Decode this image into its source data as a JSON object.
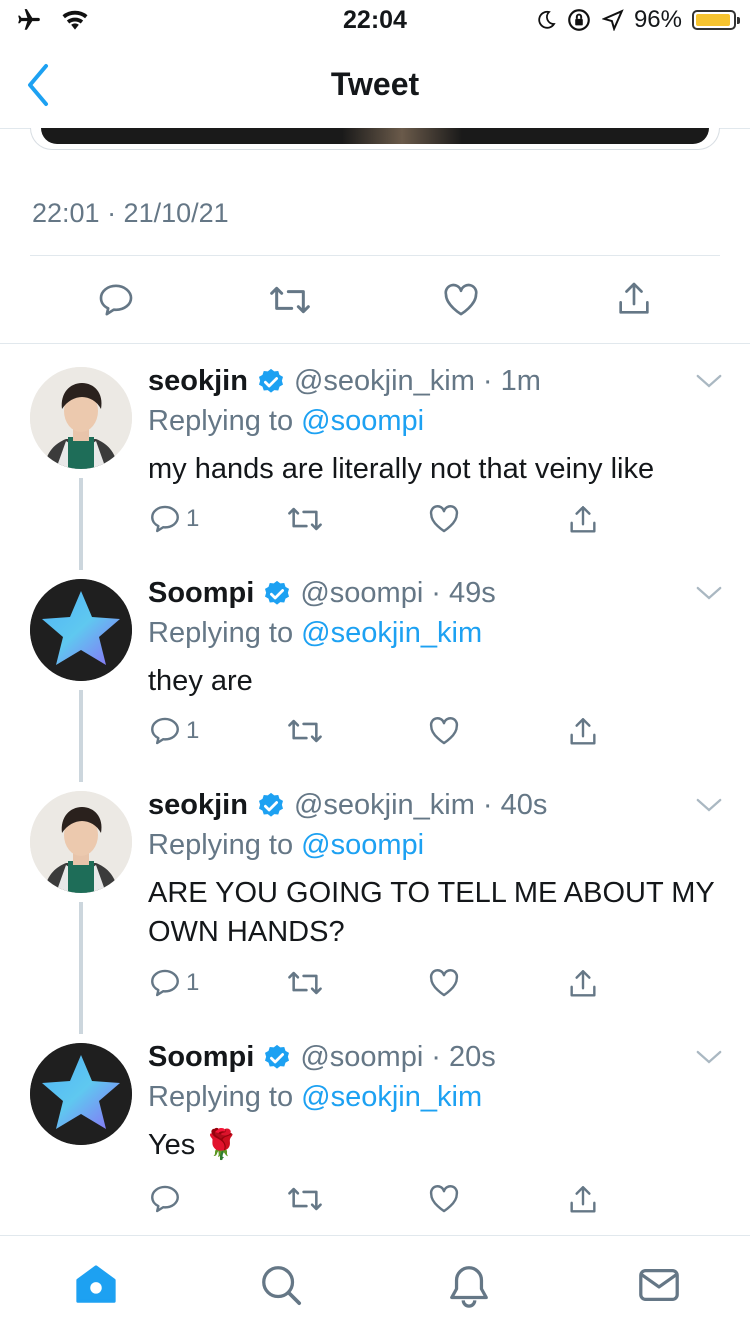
{
  "status_bar": {
    "time": "22:04",
    "battery": "96%",
    "battery_level": 0.96
  },
  "nav": {
    "title": "Tweet"
  },
  "main_tweet": {
    "timestamp": "22:01 · 21/10/21"
  },
  "replies": [
    {
      "name": "seokjin",
      "handle": "@seokjin_kim",
      "time": "1m",
      "replying_prefix": "Replying to",
      "replying_to": "@soompi",
      "text": "my hands are literally not that veiny like",
      "reply_count": "1"
    },
    {
      "name": "Soompi",
      "handle": "@soompi",
      "time": "49s",
      "replying_prefix": "Replying to",
      "replying_to": "@seokjin_kim",
      "text": "they are",
      "reply_count": "1"
    },
    {
      "name": "seokjin",
      "handle": "@seokjin_kim",
      "time": "40s",
      "replying_prefix": "Replying to",
      "replying_to": "@soompi",
      "text": "ARE YOU GOING TO TELL ME ABOUT MY OWN HANDS?",
      "reply_count": "1"
    },
    {
      "name": "Soompi",
      "handle": "@soompi",
      "time": "20s",
      "replying_prefix": "Replying to",
      "replying_to": "@seokjin_kim",
      "text": "Yes 🌹",
      "reply_count": ""
    }
  ],
  "colors": {
    "accent": "#1da1f2",
    "verified": "#1da1f2",
    "muted": "#657786",
    "battery": "#f6c32f"
  },
  "icons": [
    "airplane-icon",
    "wifi-icon",
    "moon-icon",
    "orientation-lock-icon",
    "location-icon",
    "back-icon",
    "reply-icon",
    "retweet-icon",
    "like-icon",
    "share-icon",
    "verified-icon",
    "chevron-down-icon",
    "home-icon",
    "search-icon",
    "notifications-icon",
    "messages-icon"
  ]
}
